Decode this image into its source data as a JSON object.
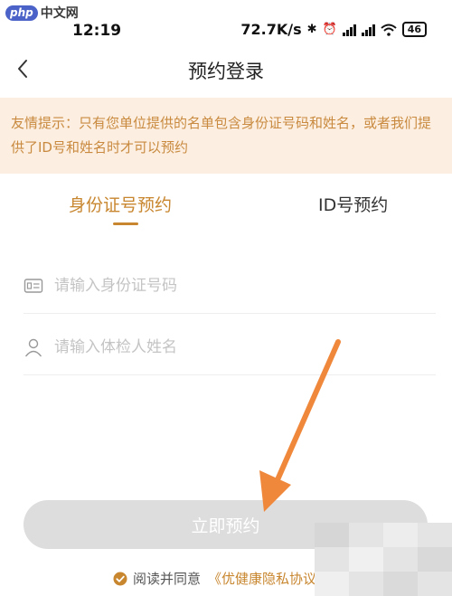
{
  "watermark": {
    "logo": "php",
    "text": "中文网"
  },
  "status_bar": {
    "time": "12:19",
    "net_speed": "72.7K/s",
    "battery": "46"
  },
  "header": {
    "title": "预约登录"
  },
  "notice": {
    "text": "友情提示：只有您单位提供的名单包含身份证号码和姓名，或者我们提供了ID号和姓名时才可以预约"
  },
  "tabs": [
    {
      "label": "身份证号预约",
      "active": true
    },
    {
      "label": "ID号预约",
      "active": false
    }
  ],
  "form": {
    "id_card": {
      "placeholder": "请输入身份证号码",
      "value": ""
    },
    "name": {
      "placeholder": "请输入体检人姓名",
      "value": ""
    },
    "submit_label": "立即预约"
  },
  "agreement": {
    "prefix": "阅读并同意",
    "link": "《优健康隐私协议"
  },
  "colors": {
    "accent": "#c8862f",
    "notice_bg": "#fcefe1",
    "notice_text": "#c98a3f",
    "button_disabled": "#dddddd",
    "annotation_arrow": "#f0883c"
  }
}
